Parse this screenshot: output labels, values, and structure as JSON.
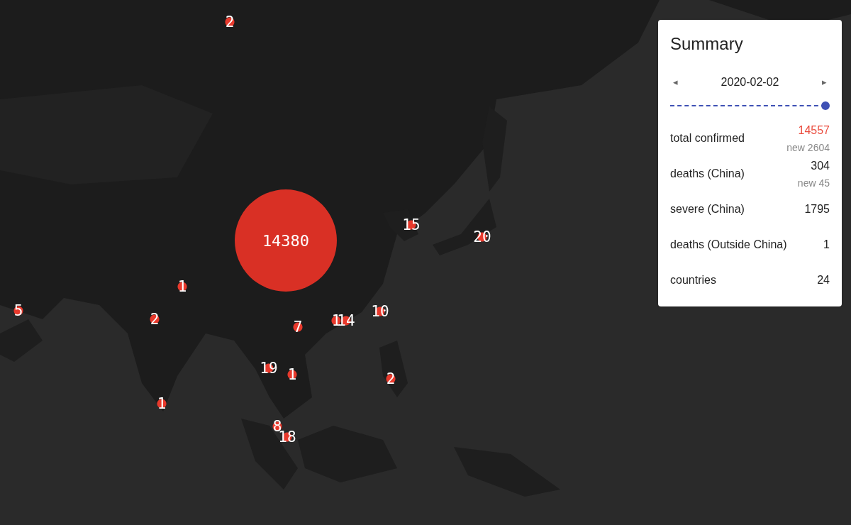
{
  "markers": [
    {
      "label": "2",
      "kind": "small"
    },
    {
      "label": "14380",
      "kind": "large"
    },
    {
      "label": "15",
      "kind": "small"
    },
    {
      "label": "20",
      "kind": "small"
    },
    {
      "label": "1",
      "kind": "small"
    },
    {
      "label": "5",
      "kind": "small"
    },
    {
      "label": "2",
      "kind": "small"
    },
    {
      "label": "7",
      "kind": "small"
    },
    {
      "label": "1",
      "kind": "small"
    },
    {
      "label": "14",
      "kind": "small"
    },
    {
      "label": "10",
      "kind": "small"
    },
    {
      "label": "19",
      "kind": "small"
    },
    {
      "label": "1",
      "kind": "small"
    },
    {
      "label": "2",
      "kind": "small"
    },
    {
      "label": "1",
      "kind": "small"
    },
    {
      "label": "8",
      "kind": "small"
    },
    {
      "label": "18",
      "kind": "small"
    }
  ],
  "summary": {
    "title": "Summary",
    "date": "2020-02-02",
    "prev": "◂",
    "next": "▸",
    "level": 1,
    "stats": [
      {
        "label": "total confirmed",
        "value": "14557",
        "highlight": true,
        "new": "new 2604"
      },
      {
        "label": "deaths (China)",
        "value": "304",
        "highlight": false,
        "new": "new 45"
      },
      {
        "label": "severe (China)",
        "value": "1795",
        "highlight": false
      },
      {
        "label": "deaths (Outside China)",
        "value": "1",
        "highlight": false
      },
      {
        "label": "countries",
        "value": "24",
        "highlight": false
      }
    ]
  }
}
